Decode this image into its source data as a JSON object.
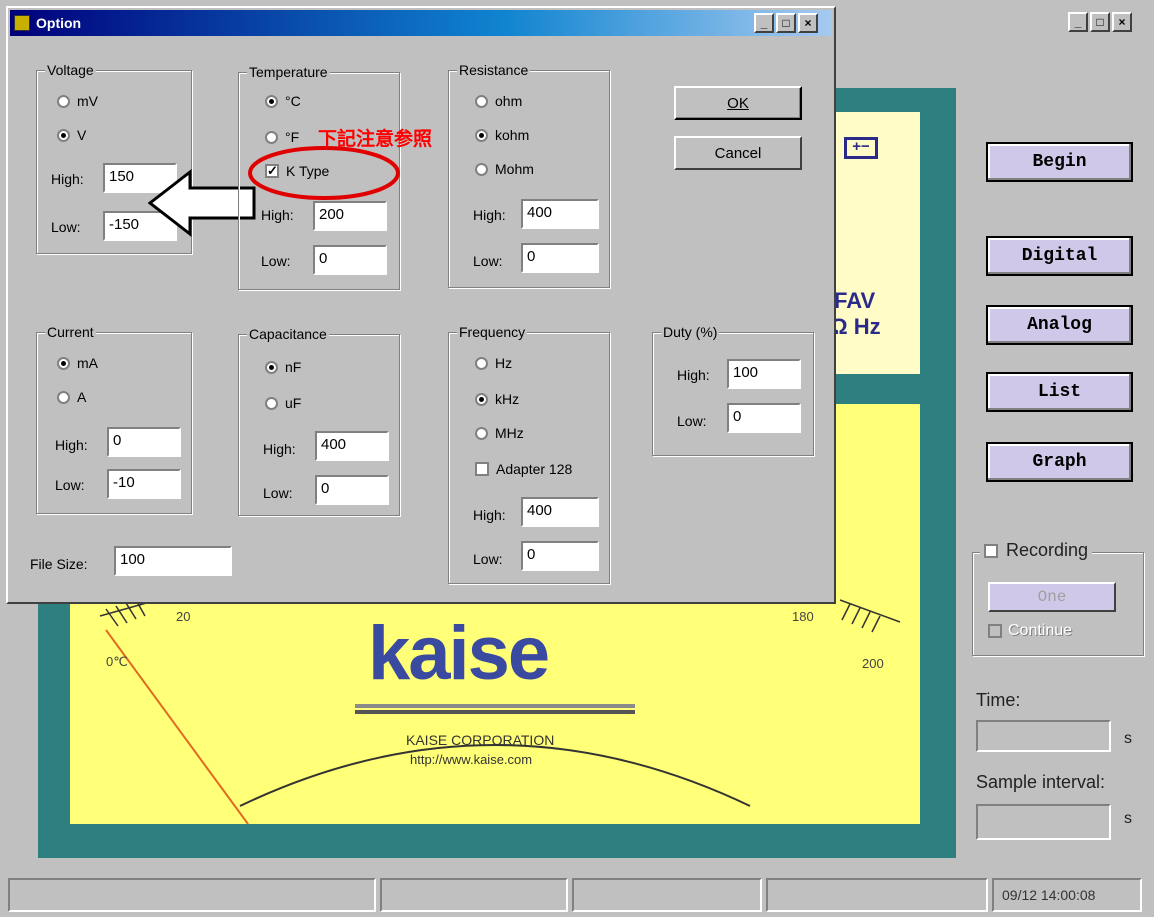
{
  "main_window": {
    "buttons": {
      "begin": "Begin",
      "digital": "Digital",
      "analog": "Analog",
      "list": "List",
      "graph": "Graph"
    },
    "recording": {
      "label": "Recording",
      "checked": false,
      "one": "One",
      "continue": "Continue"
    },
    "time_label": "Time:",
    "time_unit": "s",
    "sample_label": "Sample interval:",
    "sample_unit": "s",
    "status_time": "09/12 14:00:08",
    "meter": {
      "brand": "kaise",
      "company": "KAISE CORPORATION",
      "url": "http://www.kaise.com",
      "scale_left_low": "0℃",
      "scale_left": "20",
      "scale_right": "180",
      "scale_right_high": "200",
      "display_fav": "FAV",
      "display_hz": "Ω Hz"
    }
  },
  "dialog": {
    "title": "Option",
    "ok": "OK",
    "cancel": "Cancel",
    "voltage": {
      "title": "Voltage",
      "mv": "mV",
      "v": "V",
      "selected": "V",
      "high_label": "High:",
      "high": "150",
      "low_label": "Low:",
      "low": "-150"
    },
    "temperature": {
      "title": "Temperature",
      "c": "°C",
      "f": "°F",
      "selected": "°C",
      "ktype": "K Type",
      "ktype_checked": true,
      "high_label": "High:",
      "high": "200",
      "low_label": "Low:",
      "low": "0"
    },
    "resistance": {
      "title": "Resistance",
      "ohm": "ohm",
      "kohm": "kohm",
      "mohm": "Mohm",
      "selected": "kohm",
      "high_label": "High:",
      "high": "400",
      "low_label": "Low:",
      "low": "0"
    },
    "current": {
      "title": "Current",
      "ma": "mA",
      "a": "A",
      "selected": "mA",
      "high_label": "High:",
      "high": "0",
      "low_label": "Low:",
      "low": "-10"
    },
    "capacitance": {
      "title": "Capacitance",
      "nf": "nF",
      "uf": "uF",
      "selected": "nF",
      "high_label": "High:",
      "high": "400",
      "low_label": "Low:",
      "low": "0"
    },
    "frequency": {
      "title": "Frequency",
      "hz": "Hz",
      "khz": "kHz",
      "mhz": "MHz",
      "selected": "kHz",
      "adapter": "Adapter 128",
      "adapter_checked": false,
      "high_label": "High:",
      "high": "400",
      "low_label": "Low:",
      "low": "0"
    },
    "duty": {
      "title": "Duty (%)",
      "high_label": "High:",
      "high": "100",
      "low_label": "Low:",
      "low": "0"
    },
    "file_size_label": "File Size:",
    "file_size": "100"
  },
  "annotation": {
    "note": "下記注意参照",
    "color": "#ff0000"
  }
}
